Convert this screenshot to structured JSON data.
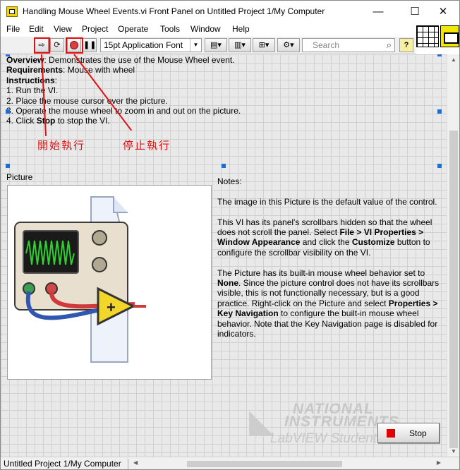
{
  "window": {
    "title": "Handling Mouse Wheel Events.vi Front Panel on Untitled Project 1/My Computer",
    "minimize_glyph": "—",
    "maximize_glyph": "☐",
    "close_glyph": "✕"
  },
  "menu": [
    "File",
    "Edit",
    "View",
    "Project",
    "Operate",
    "Tools",
    "Window",
    "Help"
  ],
  "toolbar": {
    "run_glyph": "⇨",
    "run_continuously_glyph": "⟳",
    "pause_glyph": "❚❚",
    "font": "15pt Application Font",
    "align_glyph": "▤▾",
    "distribute_glyph": "▥▾",
    "resize_glyph": "⊞▾",
    "reorder_glyph": "⚙▾",
    "search_placeholder": "Search",
    "search_glyph": "⌕",
    "help_glyph": "?"
  },
  "instructions": {
    "overview_label": "Overview",
    "overview_text": ": Demonstrates the use of the Mouse Wheel event.",
    "requirements_label": "Requirements",
    "requirements_text": ": Mouse with wheel",
    "instructions_label": "Instructions",
    "instructions_text": ":",
    "steps": [
      "1. Run the VI.",
      "2. Place the mouse cursor over the picture.",
      "3. Operate the mouse wheel to zoom in and out on the picture."
    ],
    "step4_prefix": "4. Click ",
    "step4_bold": "Stop",
    "step4_suffix": " to stop the VI."
  },
  "picture_label": "Picture",
  "notes": {
    "title": "Notes:",
    "p1": "The image in this Picture is the default value of the control.",
    "p2_a": "This VI has its panel's scrollbars hidden so that the wheel does not scroll the panel. Select ",
    "p2_b": "File > VI Properties > Window Appearance",
    "p2_c": " and click the ",
    "p2_d": "Customize",
    "p2_e": " button to configure the scrollbar visibility on the VI.",
    "p3_a": "The Picture has its built-in mouse wheel behavior set to ",
    "p3_b": "None",
    "p3_c": ". Since the picture control does not have its scrollbars visible, this is not functionally necessary, but is a good practice. Right-click on the Picture and select ",
    "p3_d": "Properties > Key Navigation",
    "p3_e": " to configure the built-in mouse wheel behavior. Note that the Key Navigation page is disabled for indicators."
  },
  "watermark": {
    "line1": "NATIONAL",
    "line2": "INSTRUMENTS",
    "line3": "LabVIEW Student Edition"
  },
  "stop_button": "Stop",
  "annotations": {
    "run_label": "開始執行",
    "abort_label": "停止執行",
    "color": "#e01010"
  },
  "status": {
    "project_path": "Untitled Project 1/My Computer"
  },
  "scroll_glyphs": {
    "up": "▲",
    "down": "▼",
    "left": "◀",
    "right": "▶"
  },
  "colors": {
    "grid": "#d0d0d0",
    "panel": "#e9e9e9",
    "selection_handle": "#1a6fd6",
    "stop_icon": "#e00000"
  }
}
